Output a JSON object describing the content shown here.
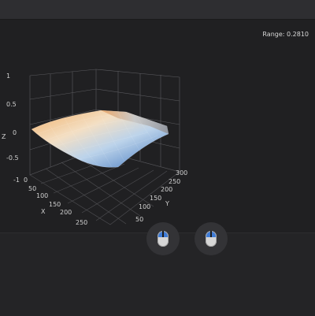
{
  "range": {
    "text": "Range: 0.2810"
  },
  "axes": {
    "z_label": "Z",
    "x_label": "X",
    "y_label": "Y",
    "z_ticks": [
      "1",
      "0.5",
      "0",
      "-0.5",
      "-1"
    ],
    "x_ticks": [
      "50",
      "100",
      "150",
      "200",
      "250"
    ],
    "y_ticks": [
      "50",
      "100",
      "150",
      "200",
      "250",
      "300"
    ],
    "origin_tick": "0"
  },
  "surface": {
    "colormap": [
      "#4f7fc4",
      "#a9c8e4",
      "#efe4cf",
      "#f4b26a",
      "#e28436"
    ]
  },
  "controls": {
    "rotate_button": {
      "icon": "mouse-icon"
    },
    "pan_button": {
      "icon": "mouse-icon"
    }
  }
}
